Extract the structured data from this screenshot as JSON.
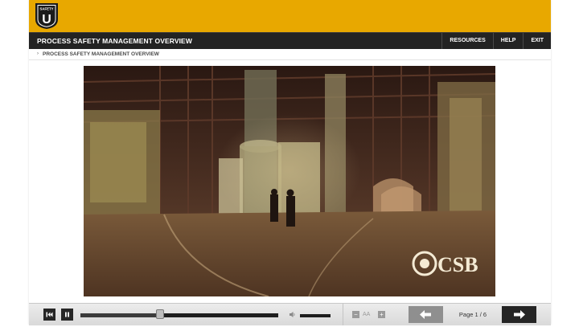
{
  "header": {
    "logo_text": "SAFETY",
    "logo_letter": "U",
    "brand_color": "#e8a800"
  },
  "titlebar": {
    "course_title": "PROCESS SAFETY MANAGEMENT OVERVIEW",
    "nav": [
      "RESOURCES",
      "HELP",
      "EXIT"
    ]
  },
  "breadcrumb": {
    "arrow": "›",
    "text": "PROCESS SAFETY MANAGEMENT OVERVIEW"
  },
  "video": {
    "watermark": "CSB",
    "scene": "industrial-plant-walkway"
  },
  "controls": {
    "rewind_icon": "rewind-to-start-icon",
    "pause_icon": "pause-icon",
    "progress": 0.4,
    "volume_icon": "speaker-icon",
    "volume": 0.85,
    "font_decrease": "−",
    "font_label": "AA",
    "font_increase": "+",
    "prev_icon": "arrow-left-icon",
    "page_label": "Page 1 / 6",
    "next_icon": "arrow-right-icon"
  }
}
